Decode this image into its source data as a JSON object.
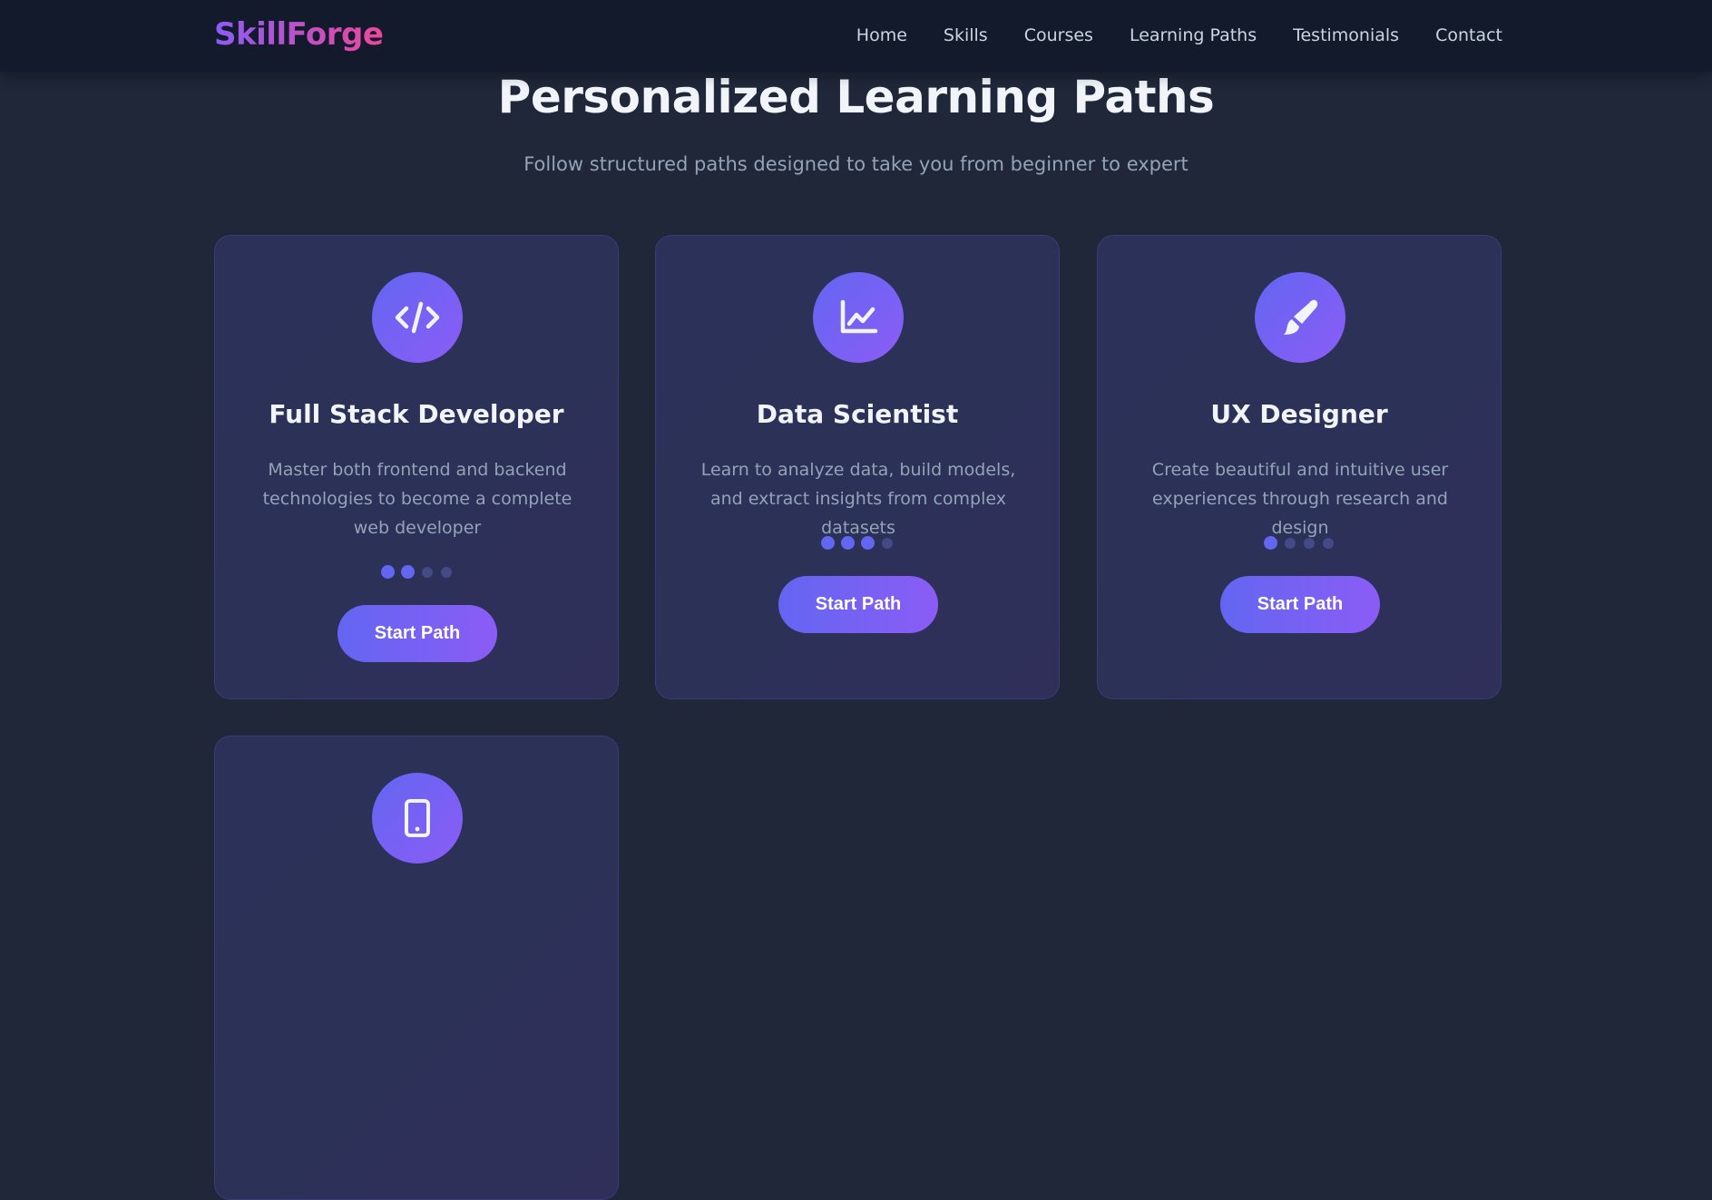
{
  "brand": {
    "name": "SkillForge"
  },
  "nav": {
    "items": [
      "Home",
      "Skills",
      "Courses",
      "Learning Paths",
      "Testimonials",
      "Contact"
    ]
  },
  "section": {
    "title": "Personalized Learning Paths",
    "subtitle": "Follow structured paths designed to take you from beginner to expert"
  },
  "paths": [
    {
      "icon": "code-icon",
      "title": "Full Stack Developer",
      "description": "Master both frontend and backend technologies to become a complete web developer",
      "difficulty": 2,
      "difficulty_max": 4,
      "button": "Start Path"
    },
    {
      "icon": "chart-line-icon",
      "title": "Data Scientist",
      "description": "Learn to analyze data, build models, and extract insights from complex datasets",
      "difficulty": 3,
      "difficulty_max": 4,
      "button": "Start Path"
    },
    {
      "icon": "paintbrush-icon",
      "title": "UX Designer",
      "description": "Create beautiful and intuitive user experiences through research and design",
      "difficulty": 1,
      "difficulty_max": 4,
      "button": "Start Path"
    },
    {
      "icon": "mobile-icon"
    }
  ],
  "colors": {
    "background": "#1f2739",
    "navbar": "#121a2c",
    "accent": "#6366f1",
    "accent_secondary": "#8b5cf6",
    "brand_gradient_end": "#ec4899"
  }
}
